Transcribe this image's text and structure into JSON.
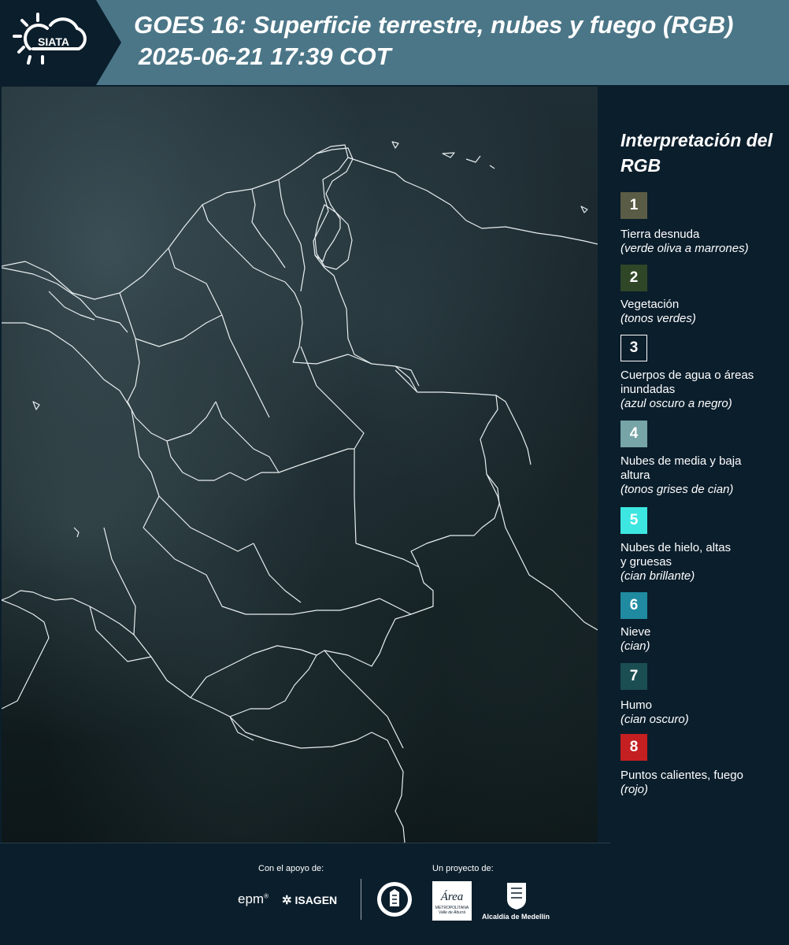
{
  "header": {
    "logo_text": "SIATA",
    "title_line1": "GOES 16: Superficie terrestre, nubes y fuego (RGB)",
    "title_line2": "2025-06-21 17:39 COT"
  },
  "legend": {
    "title": "Interpretación del RGB",
    "items": [
      {
        "num": "1",
        "name": "Tierra desnuda",
        "desc": "(verde oliva a marrones)",
        "color": "#5b5c45"
      },
      {
        "num": "2",
        "name": "Vegetación",
        "desc": "(tonos verdes)",
        "color": "#2f4727"
      },
      {
        "num": "3",
        "name": "Cuerpos de agua o áreas inundadas",
        "desc": "(azul oscuro a negro)",
        "color": "#0b1e2c"
      },
      {
        "num": "4",
        "name": "Nubes de media y baja altura",
        "desc": "(tonos grises de cian)",
        "color": "#77a4a6"
      },
      {
        "num": "5",
        "name": "Nubes de hielo, altas y gruesas",
        "desc": "(cian brillante)",
        "color": "#3de6e1"
      },
      {
        "num": "6",
        "name": "Nieve",
        "desc": "(cian)",
        "color": "#1f8aa0"
      },
      {
        "num": "7",
        "name": "Humo",
        "desc": "(cian oscuro)",
        "color": "#1b4e52"
      },
      {
        "num": "8",
        "name": "Puntos calientes, fuego",
        "desc": "(rojo)",
        "color": "#c41f21"
      }
    ]
  },
  "footer": {
    "support_label": "Con el apoyo de:",
    "project_label": "Un proyecto de:",
    "epm_text": "epm",
    "isagen_text": "ISAGEN",
    "area_text": "Área",
    "area_subtext": "METROPOLITANA",
    "area_subtext2": "Valle de Aburrá",
    "medellin_text": "Alcaldía de Medellín"
  }
}
